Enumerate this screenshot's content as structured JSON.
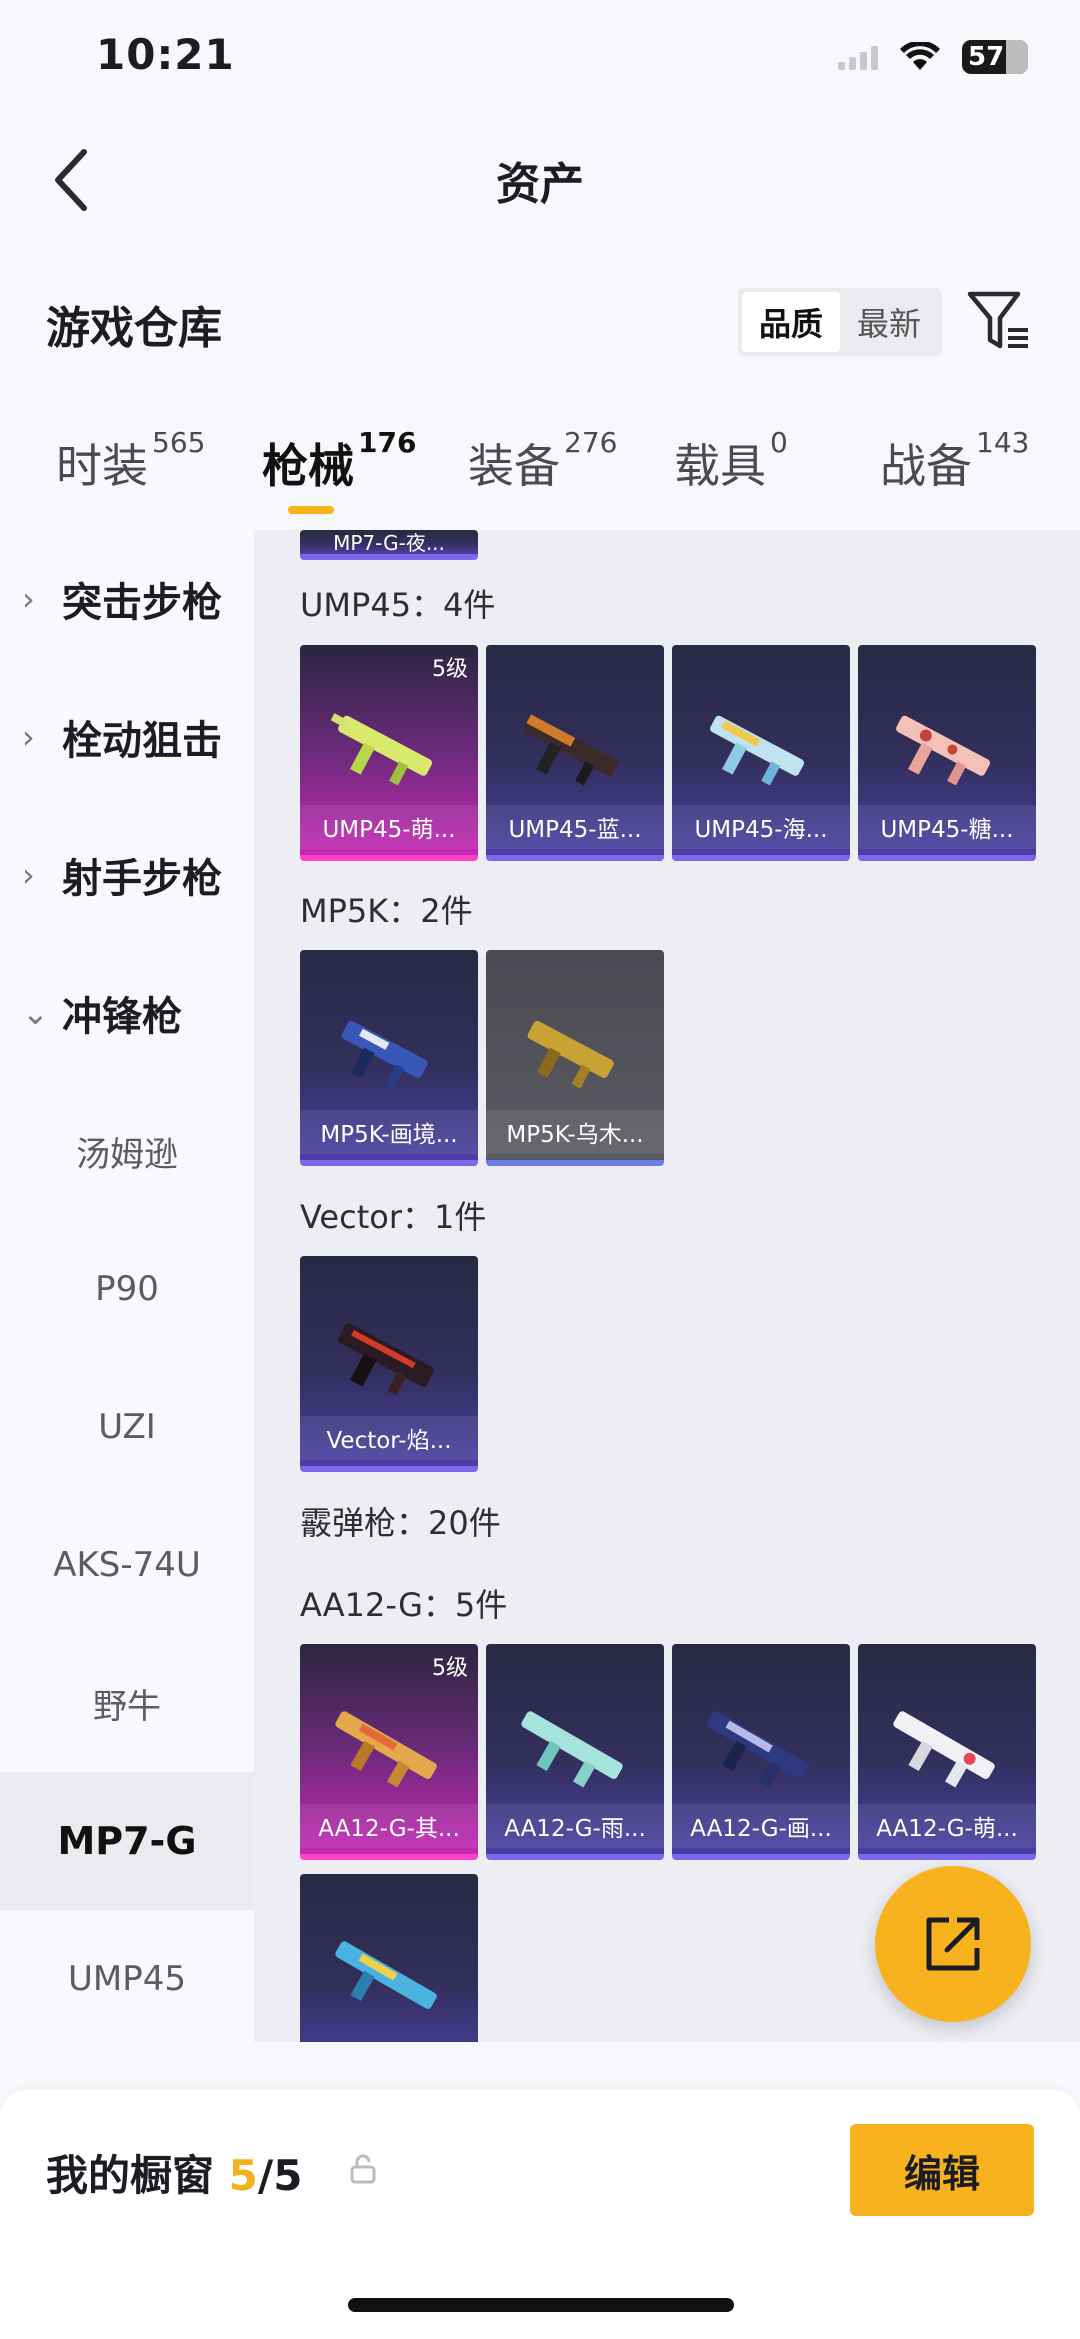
{
  "status_bar": {
    "time": "10:21",
    "battery": "57"
  },
  "header": {
    "title": "资产",
    "back_icon": "chevron-left-icon"
  },
  "section": {
    "title": "游戏仓库"
  },
  "sort": {
    "options": [
      "品质",
      "最新"
    ],
    "selected": "品质"
  },
  "filter_icon": "filter-icon",
  "tabs": [
    {
      "label": "时装",
      "count": "565"
    },
    {
      "label": "枪械",
      "count": "176",
      "active": true
    },
    {
      "label": "装备",
      "count": "276"
    },
    {
      "label": "载具",
      "count": "0"
    },
    {
      "label": "战备",
      "count": "143"
    }
  ],
  "sidebar": {
    "groups": [
      {
        "label": "突击步枪",
        "expanded": false
      },
      {
        "label": "栓动狙击",
        "expanded": false
      },
      {
        "label": "射手步枪",
        "expanded": false
      },
      {
        "label": "冲锋枪",
        "expanded": true
      }
    ],
    "items": [
      {
        "label": "汤姆逊"
      },
      {
        "label": "P90"
      },
      {
        "label": "UZI"
      },
      {
        "label": "AKS-74U"
      },
      {
        "label": "野牛"
      },
      {
        "label": "MP7-G",
        "active": true
      },
      {
        "label": "UMP45"
      }
    ]
  },
  "content": {
    "cut_card_name": "MP7-G-夜...",
    "groups": [
      {
        "label": "UMP45：4件",
        "cards": [
          {
            "name": "UMP45-萌...",
            "level": "5级",
            "rarity": "pink"
          },
          {
            "name": "UMP45-蓝...",
            "rarity": "purple"
          },
          {
            "name": "UMP45-海...",
            "rarity": "purple"
          },
          {
            "name": "UMP45-糖...",
            "rarity": "purple"
          }
        ]
      },
      {
        "label": "MP5K：2件",
        "cards": [
          {
            "name": "MP5K-画境...",
            "rarity": "purple"
          },
          {
            "name": "MP5K-乌木...",
            "rarity": "gray"
          }
        ]
      },
      {
        "label": "Vector：1件",
        "cards": [
          {
            "name": "Vector-焰...",
            "rarity": "purple"
          }
        ]
      }
    ],
    "category_label": "霰弹枪：20件",
    "aa12_group": {
      "label": "AA12-G：5件",
      "cards": [
        {
          "name": "AA12-G-其...",
          "level": "5级",
          "rarity": "pink"
        },
        {
          "name": "AA12-G-雨...",
          "rarity": "purple"
        },
        {
          "name": "AA12-G-画...",
          "rarity": "purple"
        },
        {
          "name": "AA12-G-萌...",
          "rarity": "purple"
        }
      ]
    }
  },
  "fab_icon": "share-external-icon",
  "bottom": {
    "showcase_label": "我的橱窗",
    "showcase_current": "5",
    "showcase_total": "/5",
    "lock_icon": "lock-icon",
    "edit_label": "编辑"
  },
  "colors": {
    "accent": "#f7b21d",
    "purple_rarity": "#7d67ea",
    "pink_rarity": "#ff41c8"
  }
}
